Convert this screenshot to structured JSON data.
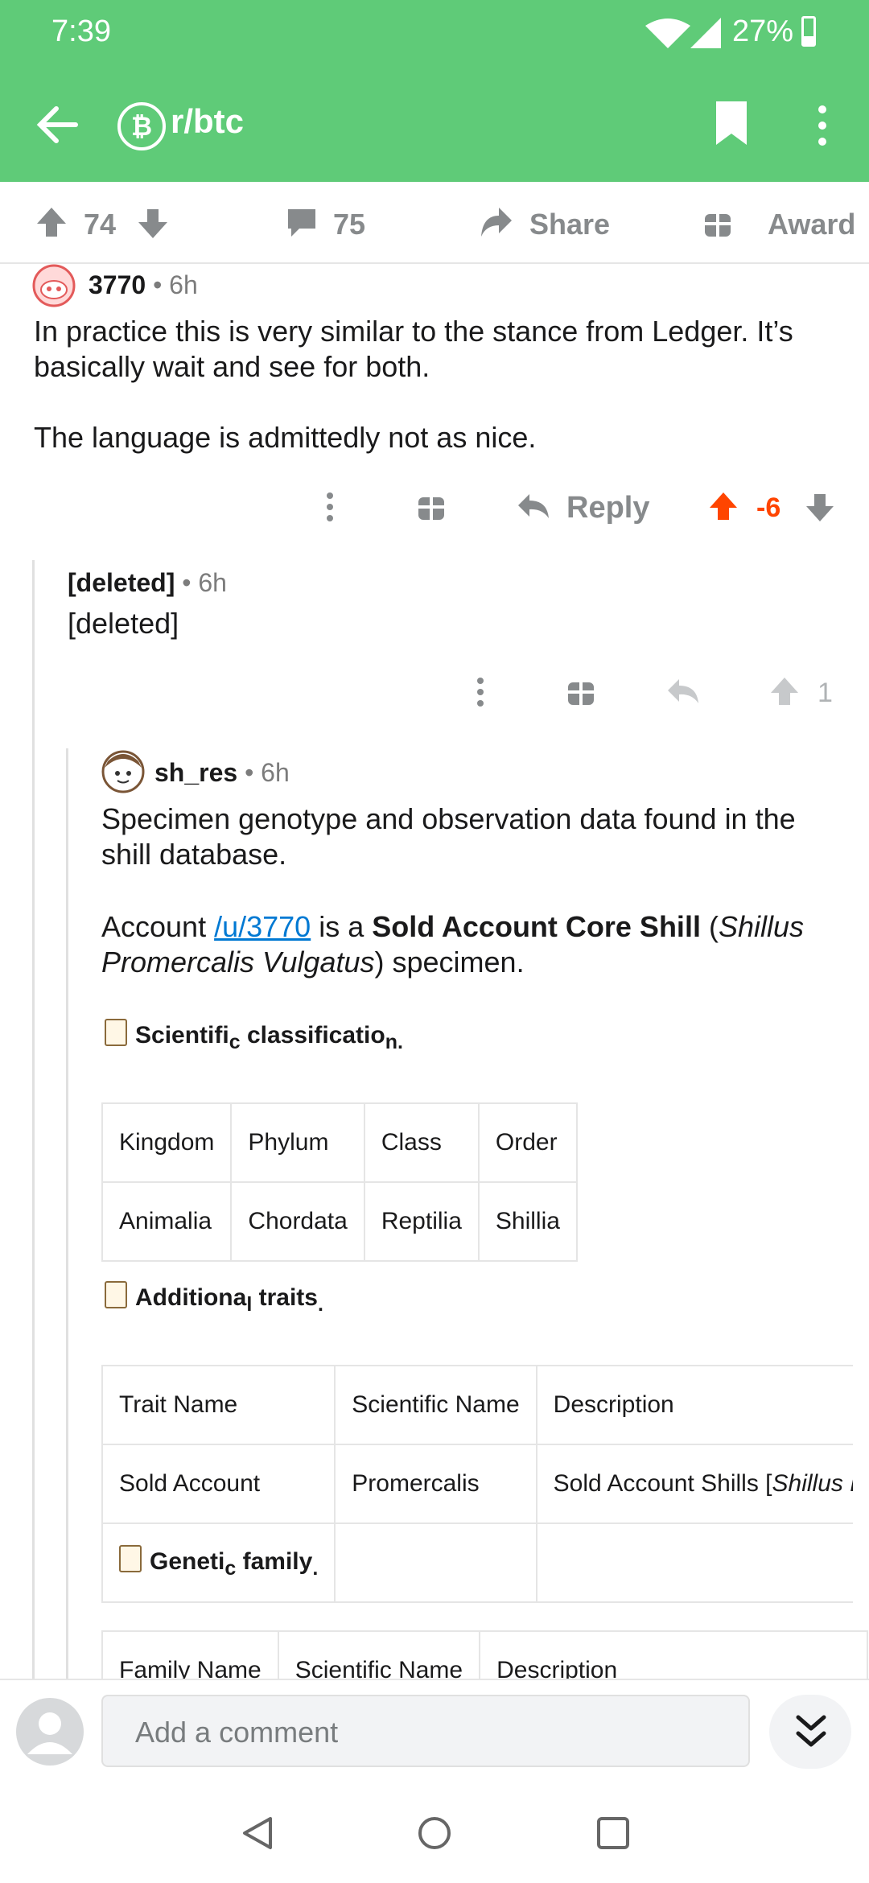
{
  "status_bar": {
    "time": "7:39",
    "battery": "27%"
  },
  "toolbar": {
    "subreddit": "r/btc",
    "subreddit_icon": "₿"
  },
  "post_actions": {
    "votes": "74",
    "comments": "75",
    "share": "Share",
    "award": "Award"
  },
  "comment1": {
    "author": "3770",
    "age": "6h",
    "body_p1": "In practice this is very similar to the stance from Ledger. It’s basically wait and see for both.",
    "body_p2": "The language is admittedly not as nice.",
    "reply": "Reply",
    "score": "-6"
  },
  "comment2": {
    "author": "[deleted]",
    "age": "6h",
    "body": "[deleted]",
    "score": "1"
  },
  "comment3": {
    "author": "sh_res",
    "age": "6h",
    "p1": "Specimen genotype and observation data found in the shill database.",
    "p2_a": "Account ",
    "p2_link": "/u/3770",
    "p2_b": " is a ",
    "p2_bold": "Sold Account Core Shill",
    "p2_c": " (",
    "p2_italic": "Shillus Promercalis Vulgatus",
    "p2_d": ") specimen.",
    "sci_head": {
      "a": "Scientifi",
      "b": "c",
      "c": " classificatio",
      "d": "n",
      "e": "."
    },
    "sci_table": {
      "headers": [
        "Kingdom",
        "Phylum",
        "Class",
        "Order"
      ],
      "row": [
        "Animalia",
        "Chordata",
        "Reptilia",
        "Shillia"
      ]
    },
    "add_head": {
      "a": "Additiona",
      "b": "l",
      "c": " traits",
      "d": "."
    },
    "traits_table": {
      "headers": [
        "Trait Name",
        "Scientific Name",
        "Description"
      ],
      "row": [
        "Sold Account",
        "Promercalis",
        "Sold Account Shills [",
        "Shillus Pr"
      ]
    },
    "gen_head": {
      "a": "Geneti",
      "b": "c",
      "c": " family",
      "d": "."
    },
    "family_table": {
      "headers": [
        "Family Name",
        "Scientific Name",
        "Description"
      ]
    }
  },
  "bottom": {
    "placeholder": "Add a comment"
  },
  "colors": {
    "header": "#5fcb78",
    "downvote": "#ff4500",
    "link": "#0079d3"
  }
}
